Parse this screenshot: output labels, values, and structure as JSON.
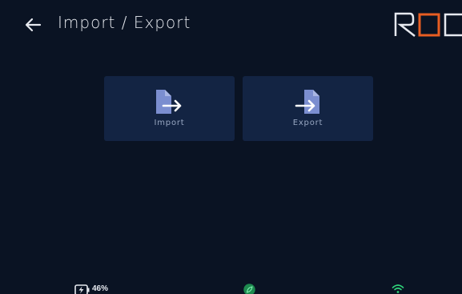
{
  "header": {
    "title": "Import / Export",
    "logo_text": "ROC"
  },
  "tiles": [
    {
      "label": "Import",
      "icon": "file-import-icon"
    },
    {
      "label": "Export",
      "icon": "file-export-icon"
    }
  ],
  "status": {
    "battery_label": "46%",
    "battery_level": 0.46,
    "battery_icon": "battery-charging-icon",
    "eco_icon": "leaf-icon",
    "wifi_icon": "wifi-icon"
  },
  "colors": {
    "background": "#0a1323",
    "tile": "#132443",
    "icon_fill": "#7b8ed0",
    "logo_accent": "#e85d22",
    "status_green": "#2fd37a"
  }
}
